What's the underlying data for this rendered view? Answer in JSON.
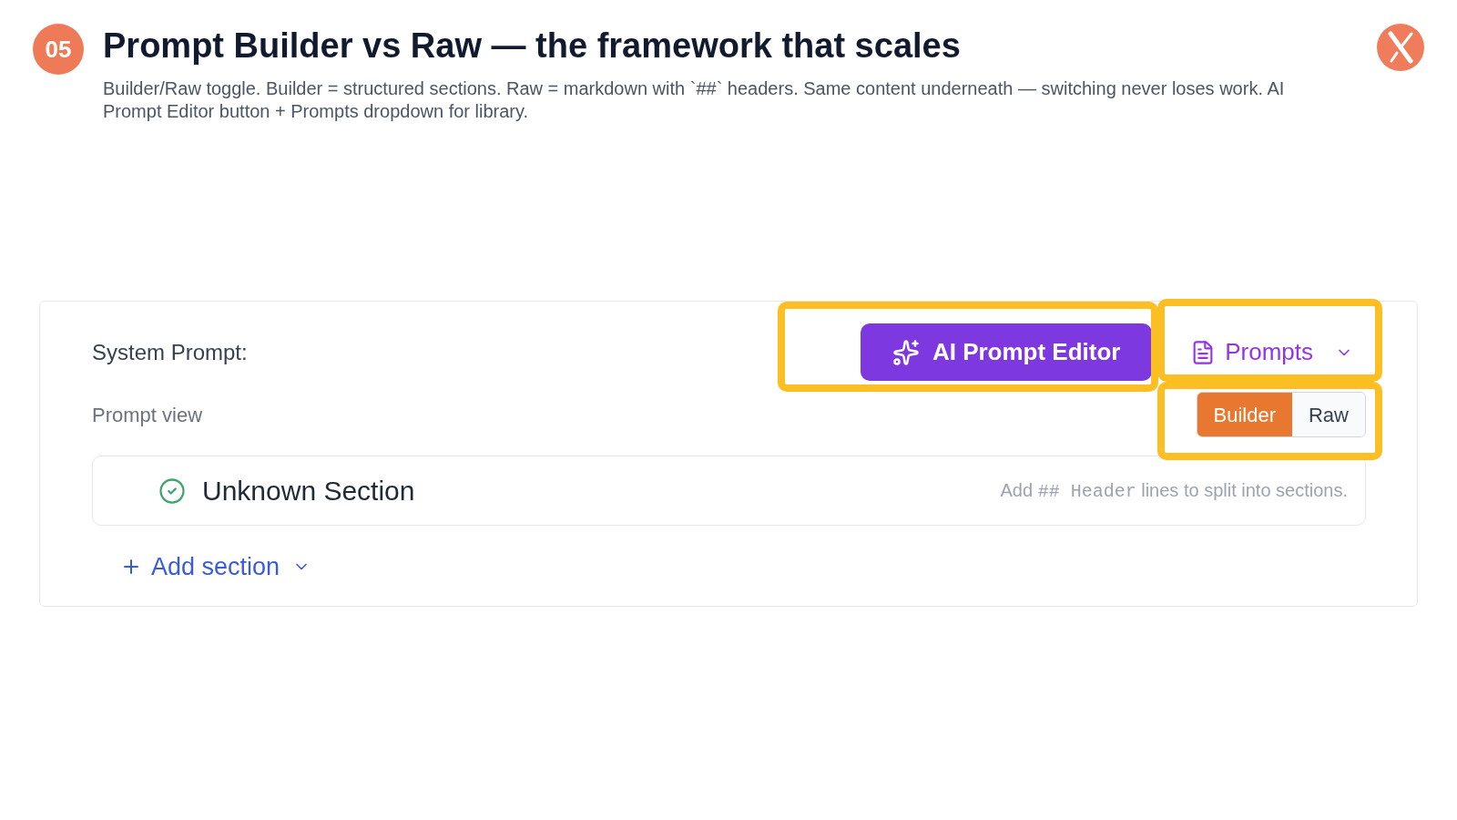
{
  "slide": {
    "number": "05",
    "title": "Prompt Builder vs Raw — the framework that scales",
    "subtitle": "Builder/Raw toggle. Builder = structured sections. Raw = markdown with `##` headers. Same content underneath — switching never loses work. AI Prompt Editor button + Prompts dropdown for library."
  },
  "editor": {
    "label": "System Prompt:",
    "ai_button": {
      "label": "AI Prompt Editor",
      "highlighted": true
    },
    "prompts_menu": {
      "label": "Prompts",
      "highlighted": true
    },
    "view_label": "Prompt view",
    "view_toggle": {
      "highlighted": true,
      "options": [
        {
          "label": "Builder",
          "selected": true
        },
        {
          "label": "Raw",
          "selected": false
        }
      ]
    },
    "sections": [
      {
        "title": "Unknown Section",
        "hint": [
          {
            "kind": "text",
            "text": "Add"
          },
          {
            "kind": "code",
            "text": "## Header"
          },
          {
            "kind": "text",
            "text": "lines to split into sections."
          }
        ]
      }
    ],
    "add_button": {
      "label": "Add section"
    }
  }
}
